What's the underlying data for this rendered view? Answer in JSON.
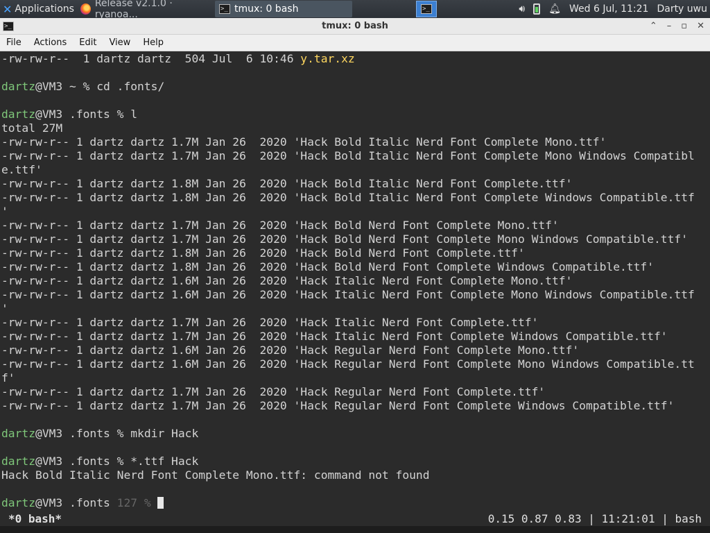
{
  "panel": {
    "applications_label": "Applications",
    "tasks": [
      {
        "label": "Release v2.1.0 · ryanoa..."
      },
      {
        "label": "tmux: 0 bash"
      }
    ],
    "clock": "Wed  6 Jul, 11:21",
    "user": "Darty uwu"
  },
  "window": {
    "title": "tmux: 0 bash",
    "icon_glyph": ">_"
  },
  "menu": [
    "File",
    "Actions",
    "Edit",
    "View",
    "Help"
  ],
  "terminal": {
    "lines": [
      {
        "segments": [
          {
            "text": "-rw-rw-r--  1 dartz dartz  504 Jul  6 10:46 "
          },
          {
            "text": "y.tar.xz",
            "cls": "yellow"
          }
        ]
      },
      {
        "segments": [
          {
            "text": ""
          }
        ]
      },
      {
        "segments": [
          {
            "text": "dartz",
            "cls": "user"
          },
          {
            "text": "@VM3 ~ % cd .fonts/"
          }
        ]
      },
      {
        "segments": [
          {
            "text": ""
          }
        ]
      },
      {
        "segments": [
          {
            "text": "dartz",
            "cls": "user"
          },
          {
            "text": "@VM3 .fonts % l"
          }
        ]
      },
      {
        "segments": [
          {
            "text": "total 27M"
          }
        ]
      },
      {
        "segments": [
          {
            "text": "-rw-rw-r-- 1 dartz dartz 1.7M Jan 26  2020 'Hack Bold Italic Nerd Font Complete Mono.ttf'"
          }
        ]
      },
      {
        "segments": [
          {
            "text": "-rw-rw-r-- 1 dartz dartz 1.7M Jan 26  2020 'Hack Bold Italic Nerd Font Complete Mono Windows Compatibl"
          }
        ]
      },
      {
        "segments": [
          {
            "text": "e.ttf'"
          }
        ]
      },
      {
        "segments": [
          {
            "text": "-rw-rw-r-- 1 dartz dartz 1.8M Jan 26  2020 'Hack Bold Italic Nerd Font Complete.ttf'"
          }
        ]
      },
      {
        "segments": [
          {
            "text": "-rw-rw-r-- 1 dartz dartz 1.8M Jan 26  2020 'Hack Bold Italic Nerd Font Complete Windows Compatible.ttf"
          }
        ]
      },
      {
        "segments": [
          {
            "text": "'"
          }
        ]
      },
      {
        "segments": [
          {
            "text": "-rw-rw-r-- 1 dartz dartz 1.7M Jan 26  2020 'Hack Bold Nerd Font Complete Mono.ttf'"
          }
        ]
      },
      {
        "segments": [
          {
            "text": "-rw-rw-r-- 1 dartz dartz 1.7M Jan 26  2020 'Hack Bold Nerd Font Complete Mono Windows Compatible.ttf'"
          }
        ]
      },
      {
        "segments": [
          {
            "text": "-rw-rw-r-- 1 dartz dartz 1.8M Jan 26  2020 'Hack Bold Nerd Font Complete.ttf'"
          }
        ]
      },
      {
        "segments": [
          {
            "text": "-rw-rw-r-- 1 dartz dartz 1.8M Jan 26  2020 'Hack Bold Nerd Font Complete Windows Compatible.ttf'"
          }
        ]
      },
      {
        "segments": [
          {
            "text": "-rw-rw-r-- 1 dartz dartz 1.6M Jan 26  2020 'Hack Italic Nerd Font Complete Mono.ttf'"
          }
        ]
      },
      {
        "segments": [
          {
            "text": "-rw-rw-r-- 1 dartz dartz 1.6M Jan 26  2020 'Hack Italic Nerd Font Complete Mono Windows Compatible.ttf"
          }
        ]
      },
      {
        "segments": [
          {
            "text": "'"
          }
        ]
      },
      {
        "segments": [
          {
            "text": "-rw-rw-r-- 1 dartz dartz 1.7M Jan 26  2020 'Hack Italic Nerd Font Complete.ttf'"
          }
        ]
      },
      {
        "segments": [
          {
            "text": "-rw-rw-r-- 1 dartz dartz 1.7M Jan 26  2020 'Hack Italic Nerd Font Complete Windows Compatible.ttf'"
          }
        ]
      },
      {
        "segments": [
          {
            "text": "-rw-rw-r-- 1 dartz dartz 1.6M Jan 26  2020 'Hack Regular Nerd Font Complete Mono.ttf'"
          }
        ]
      },
      {
        "segments": [
          {
            "text": "-rw-rw-r-- 1 dartz dartz 1.6M Jan 26  2020 'Hack Regular Nerd Font Complete Mono Windows Compatible.tt"
          }
        ]
      },
      {
        "segments": [
          {
            "text": "f'"
          }
        ]
      },
      {
        "segments": [
          {
            "text": "-rw-rw-r-- 1 dartz dartz 1.7M Jan 26  2020 'Hack Regular Nerd Font Complete.ttf'"
          }
        ]
      },
      {
        "segments": [
          {
            "text": "-rw-rw-r-- 1 dartz dartz 1.7M Jan 26  2020 'Hack Regular Nerd Font Complete Windows Compatible.ttf'"
          }
        ]
      },
      {
        "segments": [
          {
            "text": ""
          }
        ]
      },
      {
        "segments": [
          {
            "text": "dartz",
            "cls": "user"
          },
          {
            "text": "@VM3 .fonts % mkdir Hack"
          }
        ]
      },
      {
        "segments": [
          {
            "text": ""
          }
        ]
      },
      {
        "segments": [
          {
            "text": "dartz",
            "cls": "user"
          },
          {
            "text": "@VM3 .fonts % *.ttf Hack"
          }
        ]
      },
      {
        "segments": [
          {
            "text": "Hack Bold Italic Nerd Font Complete Mono.ttf: command not found"
          }
        ]
      },
      {
        "segments": [
          {
            "text": ""
          }
        ]
      },
      {
        "segments": [
          {
            "text": "dartz",
            "cls": "user"
          },
          {
            "text": "@VM3 .fonts "
          },
          {
            "text": "127 %",
            "cls": "dim"
          },
          {
            "text": " "
          }
        ],
        "cursor": true
      }
    ]
  },
  "status": {
    "window": "*0 bash*",
    "right": "0.15 0.87 0.83 | 11:21:01 | bash"
  },
  "colors": {
    "user": "#7fc77a",
    "yellow": "#ffd75f",
    "terminal_bg": "#2b2b2b"
  }
}
